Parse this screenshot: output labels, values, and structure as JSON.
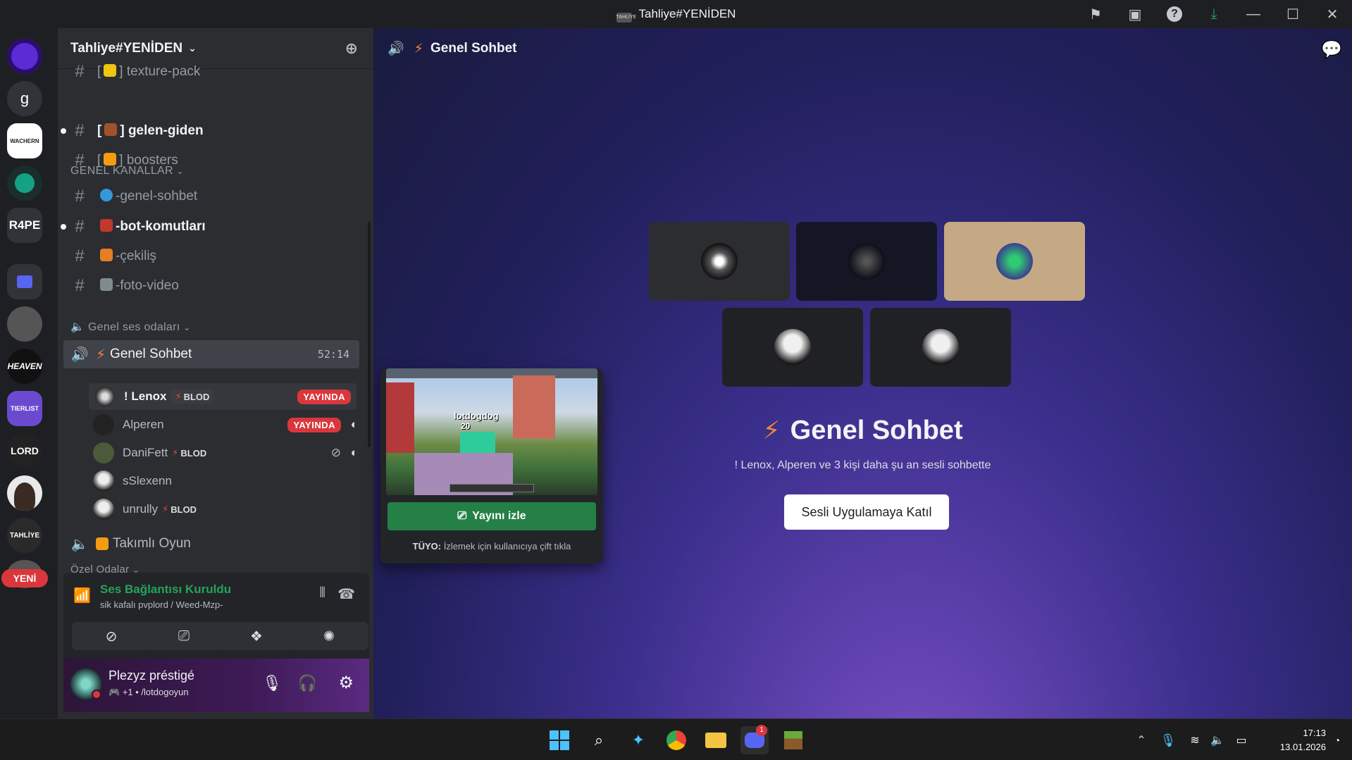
{
  "window": {
    "title": "Tahliye#YENİDEN",
    "logo_text": "TAHLİYE"
  },
  "titlebar_icons": [
    "flag-icon",
    "inbox-icon",
    "help-icon",
    "download-icon",
    "minimize-icon",
    "maximize-icon",
    "close-icon"
  ],
  "servers": [
    {
      "label": "",
      "color": "#5b2bd6"
    },
    {
      "label": "g",
      "color": "#313338"
    },
    {
      "label": "WACHERN",
      "color": "#ffffff"
    },
    {
      "label": "",
      "color": "#16a085"
    },
    {
      "label": "R4PE",
      "color": "#313338"
    },
    {
      "label": "",
      "color": "#5865f2"
    },
    {
      "label": "",
      "color": "#444444"
    },
    {
      "label": "HEAVEN",
      "color": "#111111"
    },
    {
      "label": "TIERLIST",
      "color": "#6a4bd0"
    },
    {
      "label": "LORD",
      "color": "#222222"
    },
    {
      "label": "",
      "color": "#e9e9e9"
    },
    {
      "label": "TAHLİYE",
      "color": "#2a2a2a"
    }
  ],
  "yeni_badge": "YENİ",
  "server_name": "Tahliye#YENİDEN",
  "channels_top": [
    {
      "name": "texture-pack",
      "prefix": "[",
      "suffix": "]",
      "emoji_color": "#f1c40f",
      "bold": false
    },
    {
      "name": "gelen-giden",
      "prefix": "[",
      "suffix": "]",
      "emoji_color": "#a0522d",
      "bold": true
    },
    {
      "name": "boosters",
      "prefix": "[",
      "suffix": "]",
      "emoji_color": "#f39c12",
      "bold": false
    }
  ],
  "category_general": "GENEL KANALLAR",
  "channels_general": [
    {
      "name": "-genel-sohbet",
      "emoji_color": "#3498db",
      "bold": false
    },
    {
      "name": "-bot-komutları",
      "emoji_color": "#c0392b",
      "bold": true
    },
    {
      "name": "-çekiliş",
      "emoji_color": "#e67e22",
      "bold": false
    },
    {
      "name": "-foto-video",
      "emoji_color": "#7f8c8d",
      "bold": false
    }
  ],
  "category_voice": "Genel ses odaları",
  "voice_channel": {
    "name": "Genel Sohbet",
    "time": "52:14"
  },
  "voice_users": [
    {
      "name": "! Lenox",
      "blod": "BLOD",
      "live": "YAYINDA"
    },
    {
      "name": "Alperen",
      "blod": "",
      "live": "YAYINDA"
    },
    {
      "name": "DaniFett",
      "blod": "BLOD",
      "live": ""
    },
    {
      "name": "sSlexenn",
      "blod": "",
      "live": ""
    },
    {
      "name": "unrully",
      "blod": "BLOD",
      "live": ""
    }
  ],
  "voice_channel_2": {
    "name": "Takımlı Oyun"
  },
  "category_private": "Özel Odalar",
  "voice_status": {
    "title": "Ses Bağlantısı Kuruldu",
    "subtitle": "sik kafalı pvplord / Weed-Mzp-"
  },
  "user": {
    "name": "Plezyz préstigé",
    "status": "+1 • /lotdogoyun"
  },
  "stage": {
    "header": "Genel Sohbet",
    "title": "Genel Sohbet",
    "subtitle": "! Lenox, Alperen ve 3 kişi daha şu an sesli sohbette",
    "join_button": "Sesli Uygulamaya Katıl"
  },
  "popup": {
    "watch_button": "Yayını izle",
    "tip_bold": "TÜYO:",
    "tip_text": "İzlemek için kullanıcıya çift tıkla",
    "game_name": "lotdogdog",
    "game_number": "20"
  },
  "taskbar": {
    "time": "17:13",
    "date": "13.01.2026",
    "discord_badge": "1"
  },
  "colors": {
    "accent": "#5865f2",
    "live": "#da373c",
    "green": "#248046",
    "bolt": "#f0873a"
  }
}
